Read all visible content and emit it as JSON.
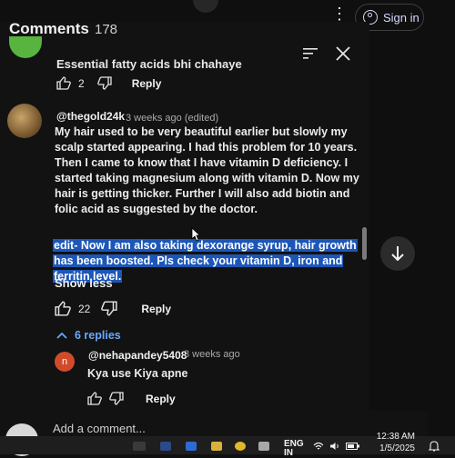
{
  "header": {
    "sign_in_label": "Sign in"
  },
  "comments_panel": {
    "title": "Comments",
    "count": "178",
    "previous_comment": {
      "text_fragment": "Essential fatty acids bhi chahaye",
      "likes": "2",
      "reply_label": "Reply"
    },
    "main_comment": {
      "author": "@thegold24k",
      "meta": "3 weeks ago (edited)",
      "body": "My hair used to be very beautiful earlier but slowly my scalp started appearing. I had this problem for 10 years. Then I came to know that I have vitamin D deficiency. I started taking magnesium along with vitamin D. Now my hair is getting thicker. Further I will also add biotin and folic acid as suggested by the doctor.",
      "edit": "edit- Now I am also taking dexorange syrup, hair growth has been boosted. Pls check your vitamin D, iron and ferritin level.",
      "show_less_label": "Show less",
      "likes": "22",
      "reply_label": "Reply",
      "replies_toggle": "6 replies"
    },
    "reply": {
      "avatar_letter": "n",
      "author": "@nehapandey5408",
      "meta": "3 weeks ago",
      "body": "Kya use Kiya apne",
      "reply_label": "Reply"
    },
    "add_comment_placeholder": "Add a comment..."
  },
  "taskbar": {
    "lang_top": "ENG",
    "lang_bottom": "IN",
    "time": "12:38 AM",
    "date": "1/5/2025"
  },
  "colors": {
    "background": "#0f0f0f",
    "highlight": "#1c56b8",
    "link_blue": "#6aa8ff",
    "reply_avatar": "#d14b2a"
  }
}
